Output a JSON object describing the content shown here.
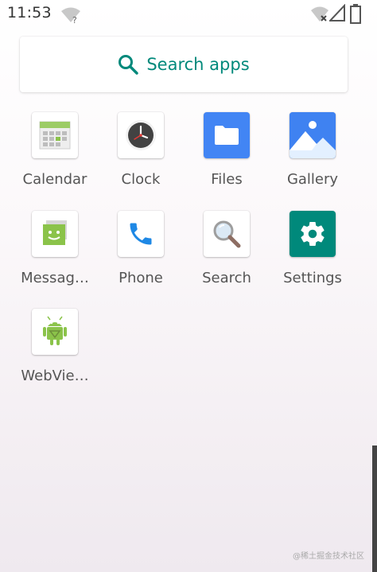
{
  "status_bar": {
    "time": "11:53",
    "icons": [
      "wifi-unknown-icon",
      "wifi-off-icon",
      "signal-icon",
      "battery-icon"
    ]
  },
  "search": {
    "label": "Search apps",
    "accent_color": "#00897b"
  },
  "apps": [
    {
      "label": "Calendar",
      "icon": "calendar-icon"
    },
    {
      "label": "Clock",
      "icon": "clock-icon"
    },
    {
      "label": "Files",
      "icon": "folder-icon"
    },
    {
      "label": "Gallery",
      "icon": "gallery-icon"
    },
    {
      "label": "Messag…",
      "icon": "messaging-icon"
    },
    {
      "label": "Phone",
      "icon": "phone-icon"
    },
    {
      "label": "Search",
      "icon": "magnifier-icon"
    },
    {
      "label": "Settings",
      "icon": "gear-icon"
    },
    {
      "label": "WebVie…",
      "icon": "android-icon"
    }
  ],
  "watermark": "@稀土掘金技术社区"
}
